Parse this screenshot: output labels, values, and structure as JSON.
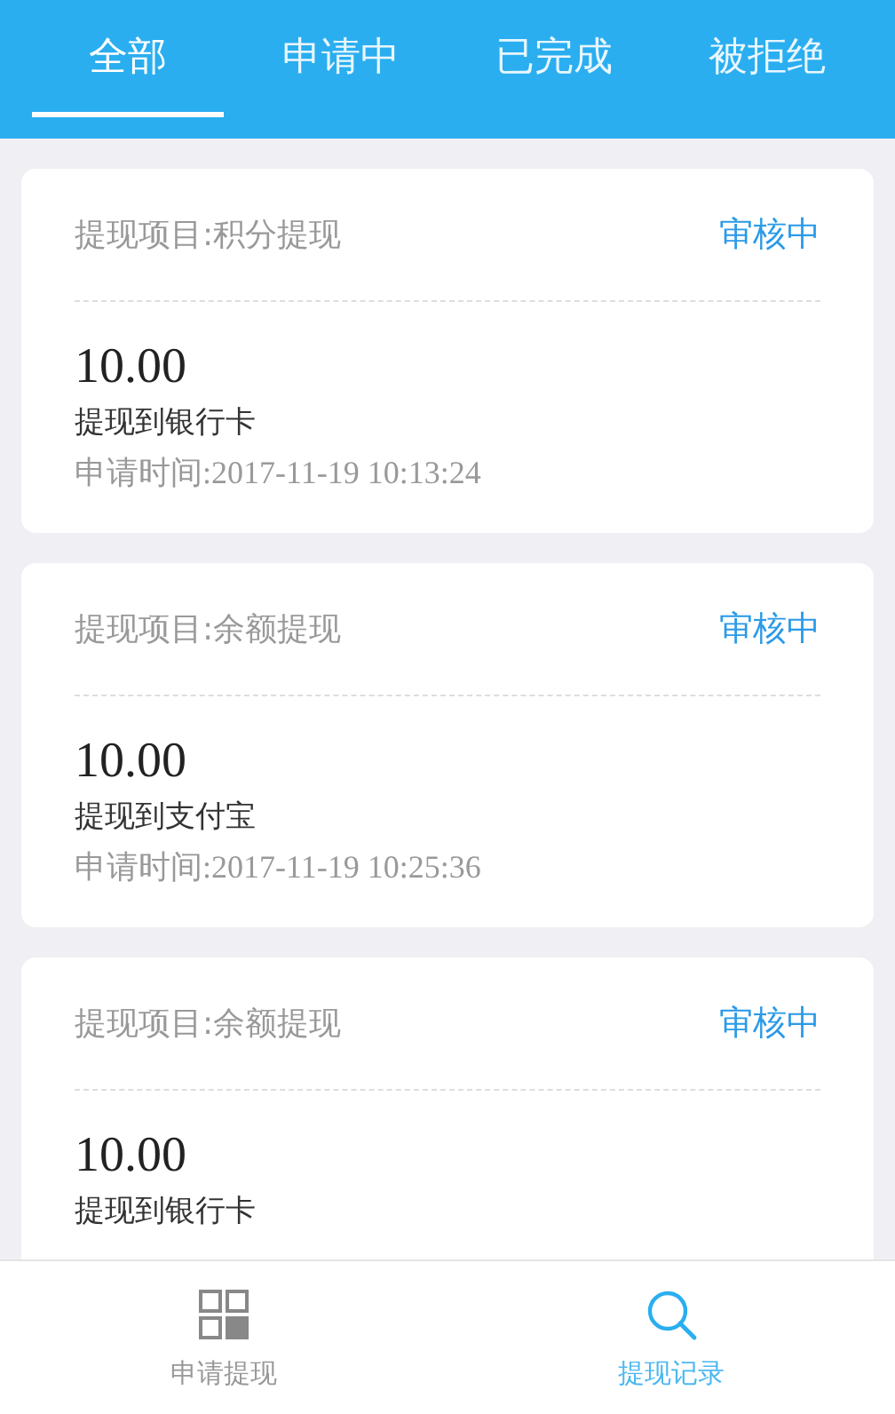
{
  "tabs": [
    {
      "label": "全部",
      "selected": true
    },
    {
      "label": "申请中",
      "selected": false
    },
    {
      "label": "已完成",
      "selected": false
    },
    {
      "label": "被拒绝",
      "selected": false
    }
  ],
  "records": [
    {
      "project": "提现项目:积分提现",
      "status": "审核中",
      "amount": "10.00",
      "method": "提现到银行卡",
      "time": "申请时间:2017-11-19 10:13:24"
    },
    {
      "project": "提现项目:余额提现",
      "status": "审核中",
      "amount": "10.00",
      "method": "提现到支付宝",
      "time": "申请时间:2017-11-19 10:25:36"
    },
    {
      "project": "提现项目:余额提现",
      "status": "审核中",
      "amount": "10.00",
      "method": "提现到银行卡"
    }
  ],
  "bottom_nav": [
    {
      "label": "申请提现",
      "kind": "grid",
      "selected": false
    },
    {
      "label": "提现记录",
      "kind": "search",
      "selected": true
    }
  ]
}
